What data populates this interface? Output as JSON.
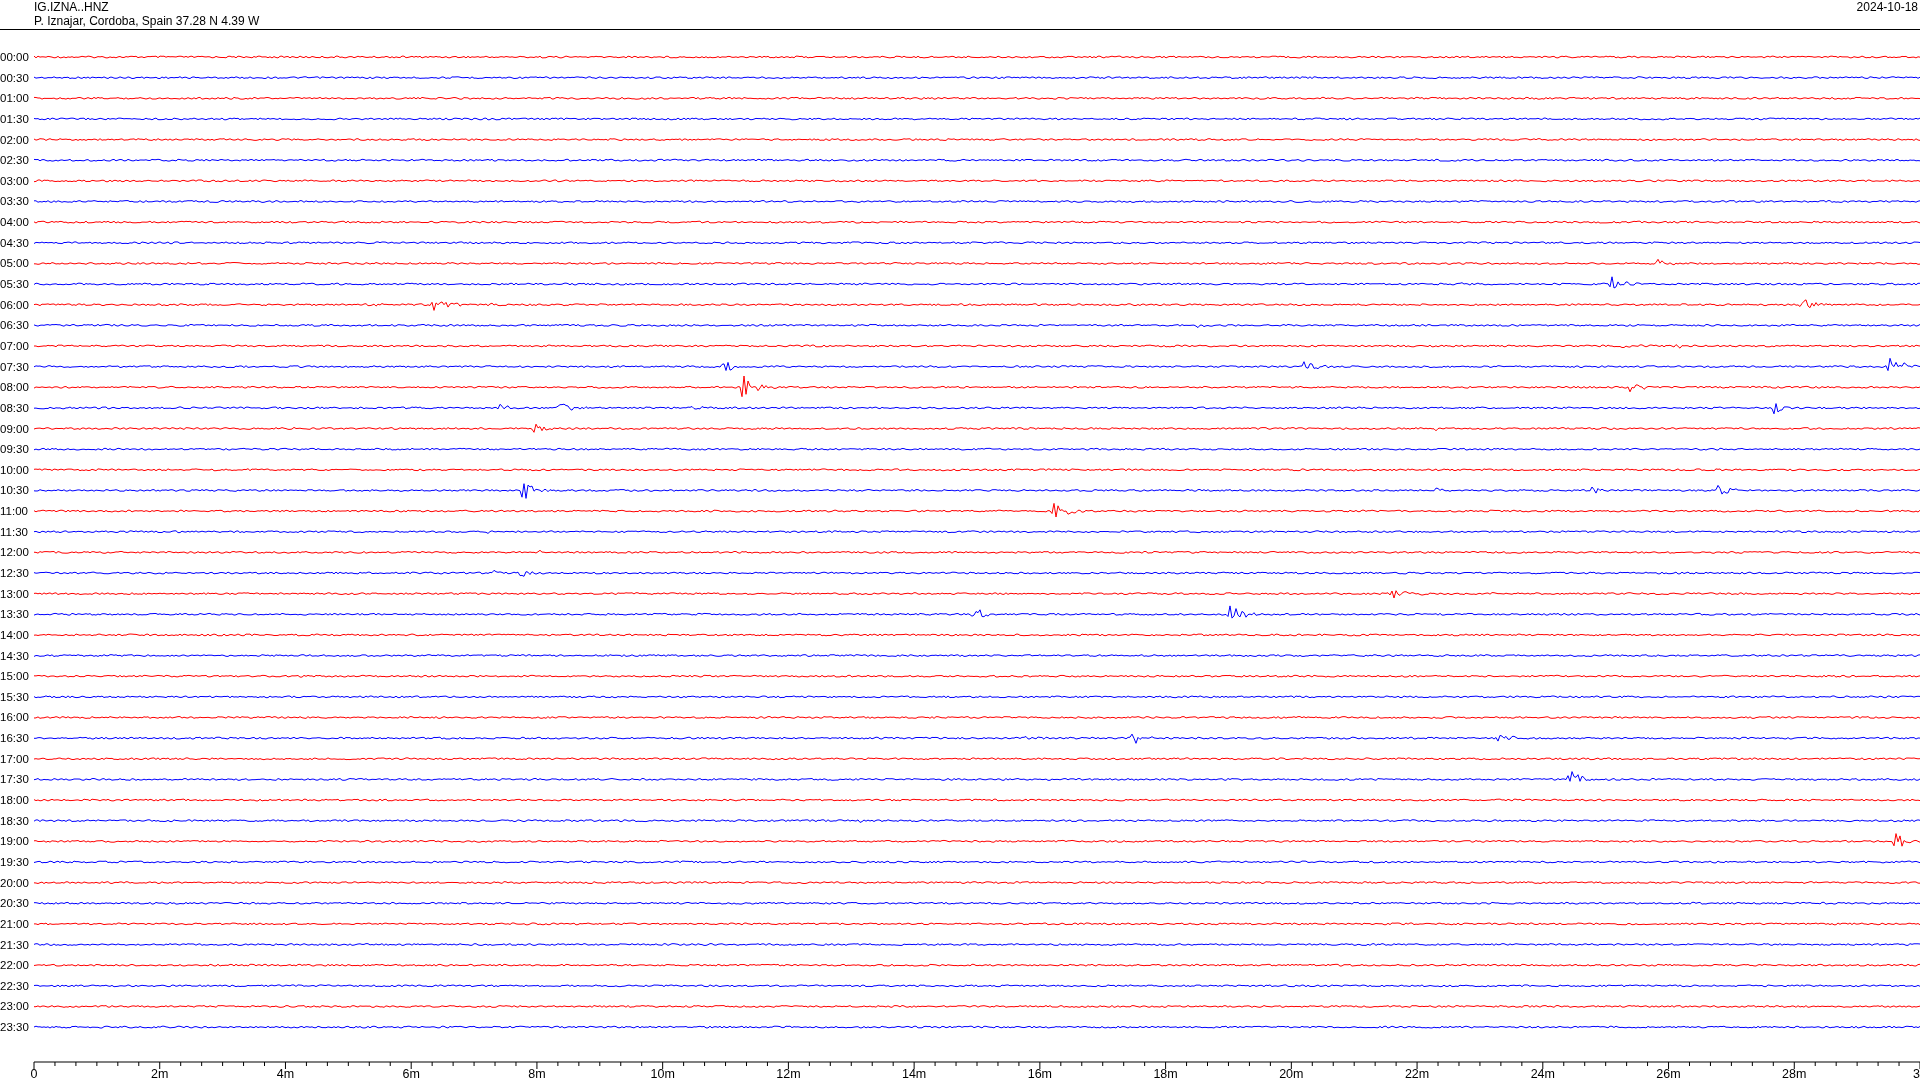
{
  "header": {
    "station": "IG.IZNA..HNZ",
    "location": "P. Iznajar, Cordoba, Spain  37.28 N 4.39 W",
    "date": "2024-10-18"
  },
  "rows": [
    {
      "time": "00:00",
      "color": "#ff0000"
    },
    {
      "time": "00:30",
      "color": "#0000ff"
    },
    {
      "time": "01:00",
      "color": "#ff0000"
    },
    {
      "time": "01:30",
      "color": "#0000ff"
    },
    {
      "time": "02:00",
      "color": "#ff0000"
    },
    {
      "time": "02:30",
      "color": "#0000ff"
    },
    {
      "time": "03:00",
      "color": "#ff0000"
    },
    {
      "time": "03:30",
      "color": "#0000ff"
    },
    {
      "time": "04:00",
      "color": "#ff0000"
    },
    {
      "time": "04:30",
      "color": "#0000ff"
    },
    {
      "time": "05:00",
      "color": "#ff0000"
    },
    {
      "time": "05:30",
      "color": "#0000ff"
    },
    {
      "time": "06:00",
      "color": "#ff0000"
    },
    {
      "time": "06:30",
      "color": "#0000ff"
    },
    {
      "time": "07:00",
      "color": "#ff0000"
    },
    {
      "time": "07:30",
      "color": "#0000ff"
    },
    {
      "time": "08:00",
      "color": "#ff0000"
    },
    {
      "time": "08:30",
      "color": "#0000ff"
    },
    {
      "time": "09:00",
      "color": "#ff0000"
    },
    {
      "time": "09:30",
      "color": "#0000ff"
    },
    {
      "time": "10:00",
      "color": "#ff0000"
    },
    {
      "time": "10:30",
      "color": "#0000ff"
    },
    {
      "time": "11:00",
      "color": "#ff0000"
    },
    {
      "time": "11:30",
      "color": "#0000ff"
    },
    {
      "time": "12:00",
      "color": "#ff0000"
    },
    {
      "time": "12:30",
      "color": "#0000ff"
    },
    {
      "time": "13:00",
      "color": "#ff0000"
    },
    {
      "time": "13:30",
      "color": "#0000ff"
    },
    {
      "time": "14:00",
      "color": "#ff0000"
    },
    {
      "time": "14:30",
      "color": "#0000ff"
    },
    {
      "time": "15:00",
      "color": "#ff0000"
    },
    {
      "time": "15:30",
      "color": "#0000ff"
    },
    {
      "time": "16:00",
      "color": "#ff0000"
    },
    {
      "time": "16:30",
      "color": "#0000ff"
    },
    {
      "time": "17:00",
      "color": "#ff0000"
    },
    {
      "time": "17:30",
      "color": "#0000ff"
    },
    {
      "time": "18:00",
      "color": "#ff0000"
    },
    {
      "time": "18:30",
      "color": "#0000ff"
    },
    {
      "time": "19:00",
      "color": "#ff0000"
    },
    {
      "time": "19:30",
      "color": "#0000ff"
    },
    {
      "time": "20:00",
      "color": "#ff0000"
    },
    {
      "time": "20:30",
      "color": "#0000ff"
    },
    {
      "time": "21:00",
      "color": "#ff0000"
    },
    {
      "time": "21:30",
      "color": "#0000ff"
    },
    {
      "time": "22:00",
      "color": "#ff0000"
    },
    {
      "time": "22:30",
      "color": "#0000ff"
    },
    {
      "time": "23:00",
      "color": "#ff0000"
    },
    {
      "time": "23:30",
      "color": "#0000ff"
    }
  ],
  "axis": {
    "labels": [
      "0",
      "2m",
      "4m",
      "6m",
      "8m",
      "10m",
      "12m",
      "14m",
      "16m",
      "18m",
      "20m",
      "22m",
      "24m",
      "26m",
      "28m",
      "3"
    ]
  }
}
